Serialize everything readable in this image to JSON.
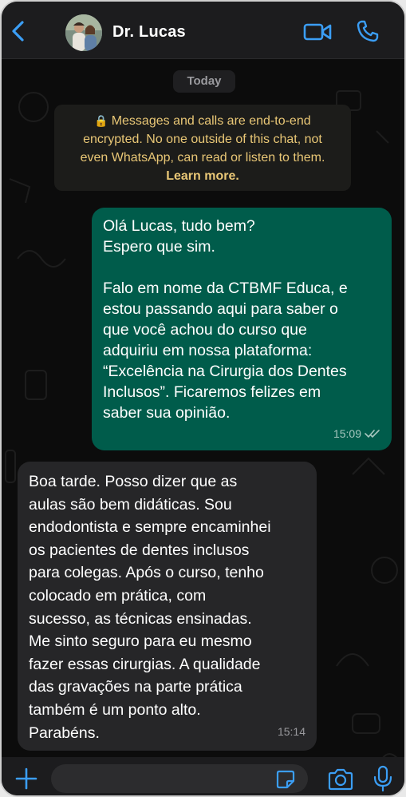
{
  "header": {
    "contact_name": "Dr. Lucas"
  },
  "chat": {
    "date_label": "Today",
    "encryption_notice": {
      "lines": [
        "Messages and calls are end-to-end",
        "encrypted. No one outside of this chat, not",
        "even WhatsApp, can read or listen to them."
      ],
      "learn_more": "Learn more."
    },
    "outgoing": {
      "lines": [
        "Olá Lucas, tudo bem?",
        "Espero que sim.",
        "",
        "Falo em nome da CTBMF Educa, e",
        "estou passando aqui para saber o",
        "que você achou do curso que",
        "adquiriu em nossa plataforma:",
        "“Excelência na Cirurgia dos Dentes",
        "Inclusos”. Ficaremos felizes em",
        "saber sua opinião."
      ],
      "time": "15:09"
    },
    "incoming": {
      "lines": [
        "Boa tarde. Posso dizer que as",
        "aulas são bem didáticas. Sou",
        "endodontista e sempre encaminhei",
        "os pacientes de dentes inclusos",
        "para colegas. Após o curso, tenho",
        "colocado em prática, com",
        "sucesso, as técnicas ensinadas.",
        "Me sinto seguro para eu mesmo",
        "fazer essas cirurgias.  A qualidade",
        "das gravações na parte prática",
        "também é um ponto alto.",
        "Parabéns."
      ],
      "time": "15:14"
    }
  },
  "footer": {
    "input_value": ""
  },
  "colors": {
    "accent": "#3b9ef5",
    "outgoing_bubble": "#005c4b",
    "incoming_bubble": "#262628",
    "encryption_text": "#e9c776"
  },
  "icons": {
    "back": "chevron-left-icon",
    "video": "video-camera-icon",
    "call": "phone-icon",
    "attach": "plus-icon",
    "sticker": "sticker-icon",
    "camera": "camera-icon",
    "mic": "microphone-icon",
    "lock": "lock-icon",
    "read_receipt": "double-check-icon"
  }
}
